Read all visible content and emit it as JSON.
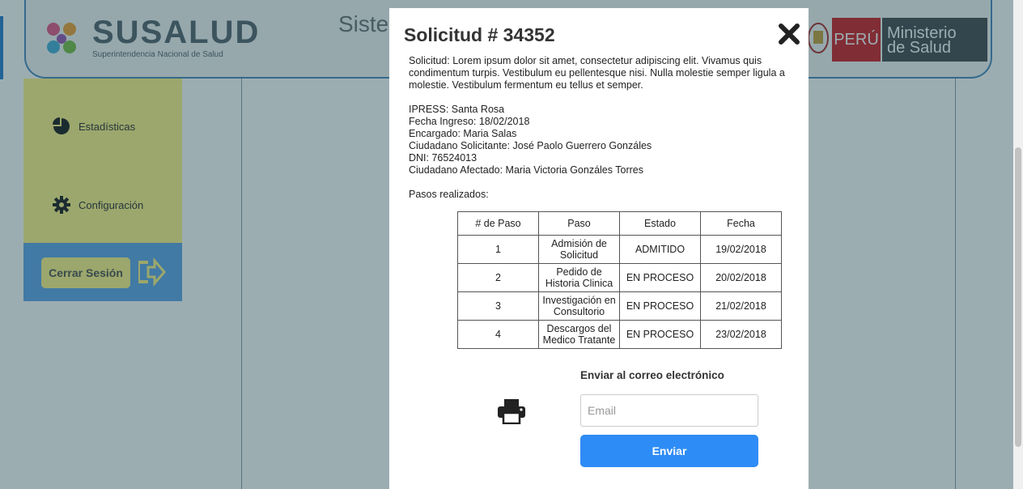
{
  "header": {
    "logo_text": "SUSALUD",
    "logo_subtitle": "Superintendencia Nacional de Salud",
    "title_partial": "Siste",
    "peru_label": "PERÚ",
    "ministry_line1": "Ministerio",
    "ministry_line2": "de Salud"
  },
  "sidebar": {
    "items": [
      {
        "label": "Estadísticas",
        "icon": "pie-chart-icon"
      },
      {
        "label": "Configuración",
        "icon": "gear-icon"
      }
    ],
    "logout_label": "Cerrar Sesión",
    "logout_icon": "arrow-right-icon"
  },
  "modal": {
    "title": "Solicitud # 34352",
    "description": "Solicitud: Lorem ipsum dolor sit amet, consectetur adipiscing elit. Vivamus quis condimentum turpis. Vestibulum eu pellentesque nisi. Nulla molestie semper ligula a molestie. Vestibulum fermentum eu tellus et semper.",
    "info": [
      "IPRESS: Santa Rosa",
      "Fecha Ingreso: 18/02/2018",
      "Encargado: Maria Salas",
      "Ciudadano Solicitante: José Paolo Guerrero Gonzáles",
      "DNI: 76524013",
      "Ciudadano Afectado: Maria Victoria Gonzáles Torres"
    ],
    "steps_label": "Pasos realizados:",
    "table": {
      "headers": [
        "# de Paso",
        "Paso",
        "Estado",
        "Fecha"
      ],
      "rows": [
        [
          "1",
          "Admisión de Solicitud",
          "ADMITIDO",
          "19/02/2018"
        ],
        [
          "2",
          "Pedido de Historia Clinica",
          "EN PROCESO",
          "20/02/2018"
        ],
        [
          "3",
          "Investigación en Consultorio",
          "EN PROCESO",
          "21/02/2018"
        ],
        [
          "4",
          "Descargos del Medico Tratante",
          "EN PROCESO",
          "23/02/2018"
        ]
      ]
    },
    "email_label": "Enviar al correo electrónico",
    "email_placeholder": "Email",
    "email_value": "",
    "send_label": "Enviar",
    "close_icon": "close-icon",
    "print_icon": "printer-icon"
  },
  "colors": {
    "accent_blue": "#2e8cf7",
    "sidebar_yellow": "#fff48a",
    "sidebar_blue": "#62a8e8",
    "peru_red": "#d0232a"
  }
}
